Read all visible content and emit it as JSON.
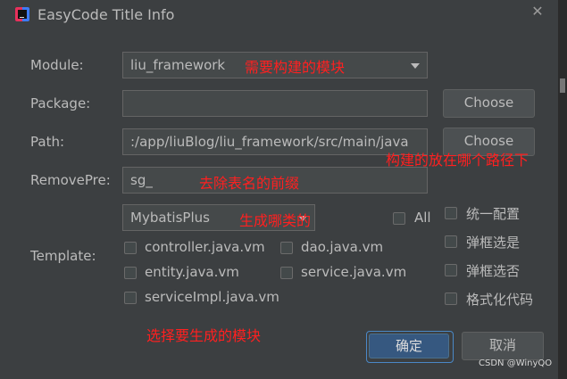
{
  "window": {
    "title": "EasyCode Title Info"
  },
  "form": {
    "module_label": "Module:",
    "module_value": "liu_framework",
    "package_label": "Package:",
    "package_value": "",
    "path_label": "Path:",
    "path_value": ":/app/liuBlog/liu_framework/src/main/java",
    "removepre_label": "RemovePre:",
    "removepre_value": "sg_",
    "template_label": "Template:",
    "template_value": "MybatisPlus",
    "choose_label": "Choose",
    "all_label": "All"
  },
  "templates": [
    {
      "label": "controller.java.vm",
      "checked": false
    },
    {
      "label": "dao.java.vm",
      "checked": false
    },
    {
      "label": "entity.java.vm",
      "checked": false
    },
    {
      "label": "service.java.vm",
      "checked": false
    },
    {
      "label": "serviceImpl.java.vm",
      "checked": false
    }
  ],
  "options": [
    {
      "label": "统一配置",
      "checked": false
    },
    {
      "label": "弹框选是",
      "checked": false
    },
    {
      "label": "弹框选否",
      "checked": false
    },
    {
      "label": "格式化代码",
      "checked": false
    }
  ],
  "buttons": {
    "ok": "确定",
    "cancel": "取消"
  },
  "annotations": {
    "module": "需要构建的模块",
    "path": "构建的放在哪个路径下",
    "removepre": "去除表名的前缀",
    "template": "生成哪类的",
    "modules": "选择要生成的模块"
  },
  "watermark": "CSDN @WinyQO",
  "colors": {
    "annotation": "#ff2020",
    "primary_button": "#365880",
    "background": "#3c3f41"
  }
}
